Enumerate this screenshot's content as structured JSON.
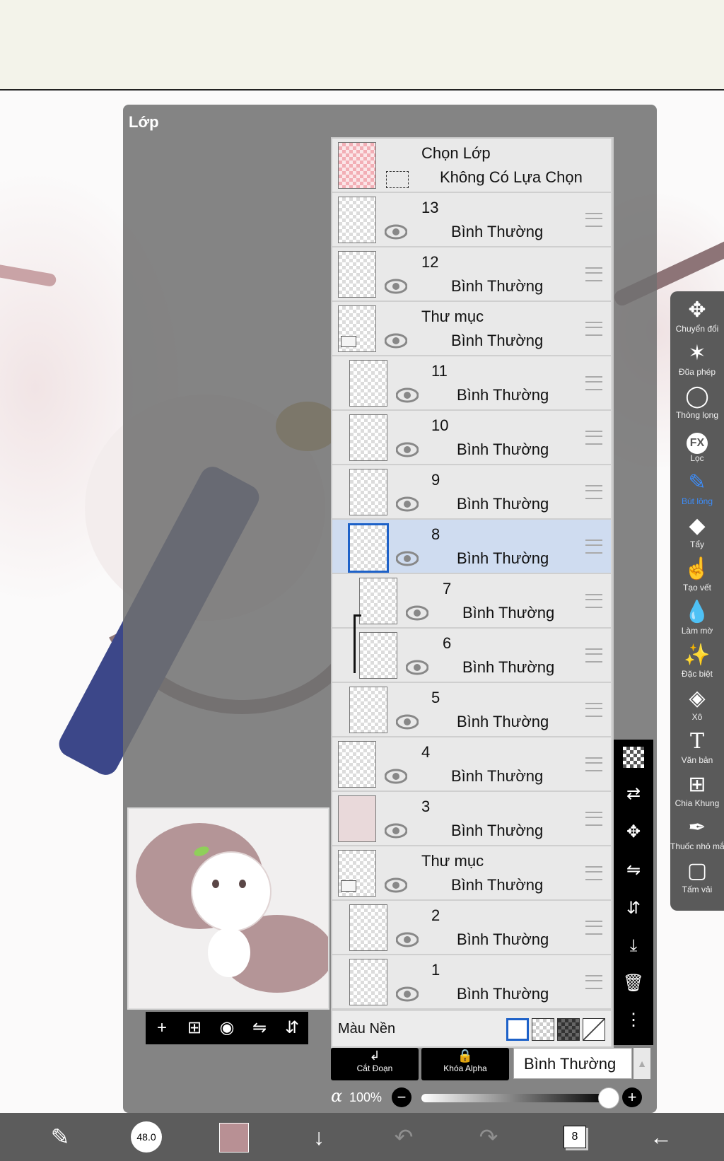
{
  "panel": {
    "title": "Lớp"
  },
  "selection_row": {
    "title": "Chọn Lớp",
    "subtitle": "Không Có Lựa Chọn"
  },
  "layers": [
    {
      "name": "13",
      "mode": "Bình Thường"
    },
    {
      "name": "12",
      "mode": "Bình Thường"
    },
    {
      "name": "Thư mục",
      "mode": "Bình Thường"
    },
    {
      "name": "11",
      "mode": "Bình Thường"
    },
    {
      "name": "10",
      "mode": "Bình Thường"
    },
    {
      "name": "9",
      "mode": "Bình Thường"
    },
    {
      "name": "8",
      "mode": "Bình Thường",
      "selected": true
    },
    {
      "name": "7",
      "mode": "Bình Thường"
    },
    {
      "name": "6",
      "mode": "Bình Thường"
    },
    {
      "name": "5",
      "mode": "Bình Thường"
    },
    {
      "name": "4",
      "mode": "Bình Thường"
    },
    {
      "name": "3",
      "mode": "Bình Thường"
    },
    {
      "name": "Thư mục",
      "mode": "Bình Thường"
    },
    {
      "name": "2",
      "mode": "Bình Thường"
    },
    {
      "name": "1",
      "mode": "Bình Thường"
    }
  ],
  "background": {
    "label": "Màu Nền"
  },
  "controls": {
    "clip_label": "Cắt Đoạn",
    "alpha_lock_label": "Khóa Alpha",
    "blend_mode": "Bình Thường",
    "alpha_symbol": "α",
    "opacity": "100%"
  },
  "tools": [
    {
      "label": "Chuyển đổi",
      "icon": "move-icon"
    },
    {
      "label": "Đũa phép",
      "icon": "magic-wand-icon"
    },
    {
      "label": "Thòng lọng",
      "icon": "lasso-icon"
    },
    {
      "label": "Lọc",
      "icon": "fx-icon"
    },
    {
      "label": "Bút lông",
      "icon": "brush-icon",
      "active": true
    },
    {
      "label": "Tẩy",
      "icon": "eraser-icon"
    },
    {
      "label": "Tạo vết",
      "icon": "smudge-icon"
    },
    {
      "label": "Làm mờ",
      "icon": "blur-icon"
    },
    {
      "label": "Đặc biệt",
      "icon": "special-icon"
    },
    {
      "label": "Xô",
      "icon": "bucket-icon"
    },
    {
      "label": "Văn bản",
      "icon": "text-icon"
    },
    {
      "label": "Chia Khung",
      "icon": "frame-divider-icon"
    },
    {
      "label": "Thuốc nhỏ mắt",
      "icon": "eyedropper-icon"
    },
    {
      "label": "Tấm vải",
      "icon": "canvas-icon"
    }
  ],
  "bottombar": {
    "brush_size": "48.0",
    "layer_count": "8",
    "color": "#b89094"
  },
  "colors": {
    "selected_row": "#cfdcf0",
    "accent": "#3c8dfb",
    "panel": "#707070"
  }
}
